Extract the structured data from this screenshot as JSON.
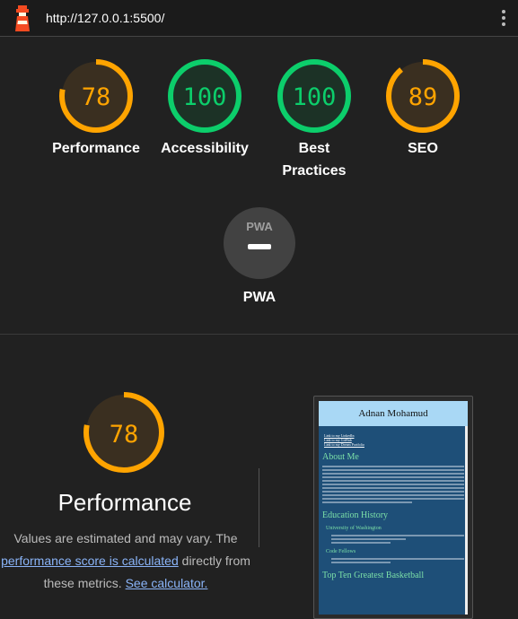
{
  "topbar": {
    "url": "http://127.0.0.1:5500/"
  },
  "colors": {
    "average": "#ffa400",
    "pass": "#0cce6b",
    "na": "#9e9e9e"
  },
  "gauges": [
    {
      "score": "78",
      "label": "Performance",
      "status": "average"
    },
    {
      "score": "100",
      "label": "Accessibility",
      "status": "pass"
    },
    {
      "score": "100",
      "label": "Best Practices",
      "status": "pass"
    },
    {
      "score": "89",
      "label": "SEO",
      "status": "average"
    }
  ],
  "pwa": {
    "badge": "PWA",
    "label": "PWA"
  },
  "performance": {
    "score": "78",
    "title": "Performance",
    "desc_part1": "Values are estimated and may vary. The ",
    "desc_link1": "performance score is calculated",
    "desc_part2": " directly from these metrics. ",
    "desc_link2": "See calculator."
  },
  "screenshot": {
    "header": "Adnan Mohamud",
    "links": [
      "Link to my LinkedIn",
      "Link to my GitHub",
      "Link to my Dream Portfolio"
    ],
    "about_heading": "About Me",
    "education_heading": "Education History",
    "school": "University of Washington",
    "code_school": "Code Fellows",
    "basketball_heading": "Top Ten Greatest Basketball"
  }
}
